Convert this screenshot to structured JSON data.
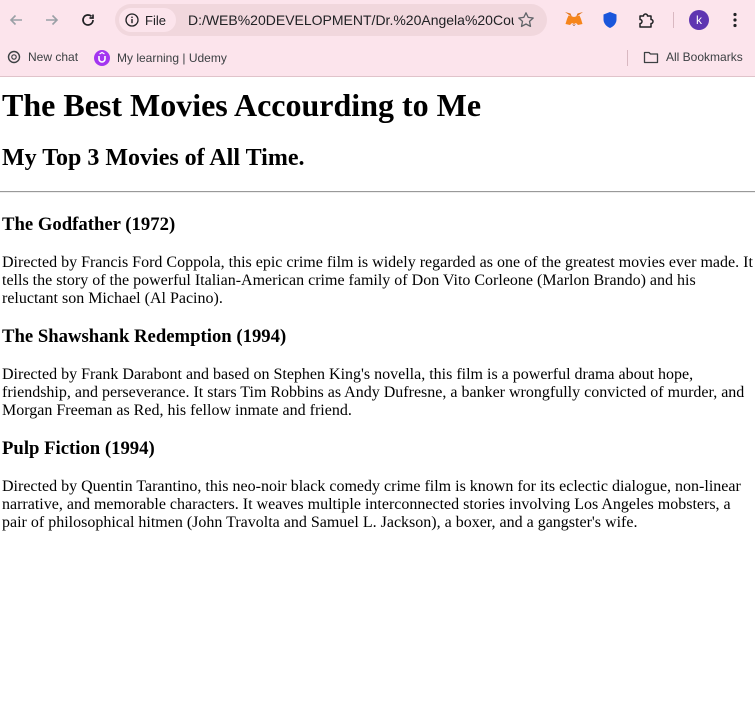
{
  "browser": {
    "site_chip": "File",
    "url": "D:/WEB%20DEVELOPMENT/Dr.%20Angela%20Cou...",
    "profile_initial": "k",
    "bookmarks": [
      {
        "label": "New chat",
        "icon": "openai-icon"
      },
      {
        "label": "My learning | Udemy",
        "icon": "udemy-icon"
      }
    ],
    "all_bookmarks": "All Bookmarks"
  },
  "page": {
    "title": "The Best Movies Accourding to Me",
    "subtitle": "My Top 3 Movies of All Time.",
    "movies": [
      {
        "heading": "The Godfather (1972)",
        "description": "Directed by Francis Ford Coppola, this epic crime film is widely regarded as one of the greatest movies ever made. It tells the story of the powerful Italian-American crime family of Don Vito Corleone (Marlon Brando) and his reluctant son Michael (Al Pacino)."
      },
      {
        "heading": "The Shawshank Redemption (1994)",
        "description": "Directed by Frank Darabont and based on Stephen King's novella, this film is a powerful drama about hope, friendship, and perseverance. It stars Tim Robbins as Andy Dufresne, a banker wrongfully convicted of murder, and Morgan Freeman as Red, his fellow inmate and friend."
      },
      {
        "heading": "Pulp Fiction (1994)",
        "description": "Directed by Quentin Tarantino, this neo-noir black comedy crime film is known for its eclectic dialogue, non-linear narrative, and memorable characters. It weaves multiple interconnected stories involving Los Angeles mobsters, a pair of philosophical hitmen (John Travolta and Samuel L. Jackson), a boxer, and a gangster's wife."
      }
    ]
  }
}
